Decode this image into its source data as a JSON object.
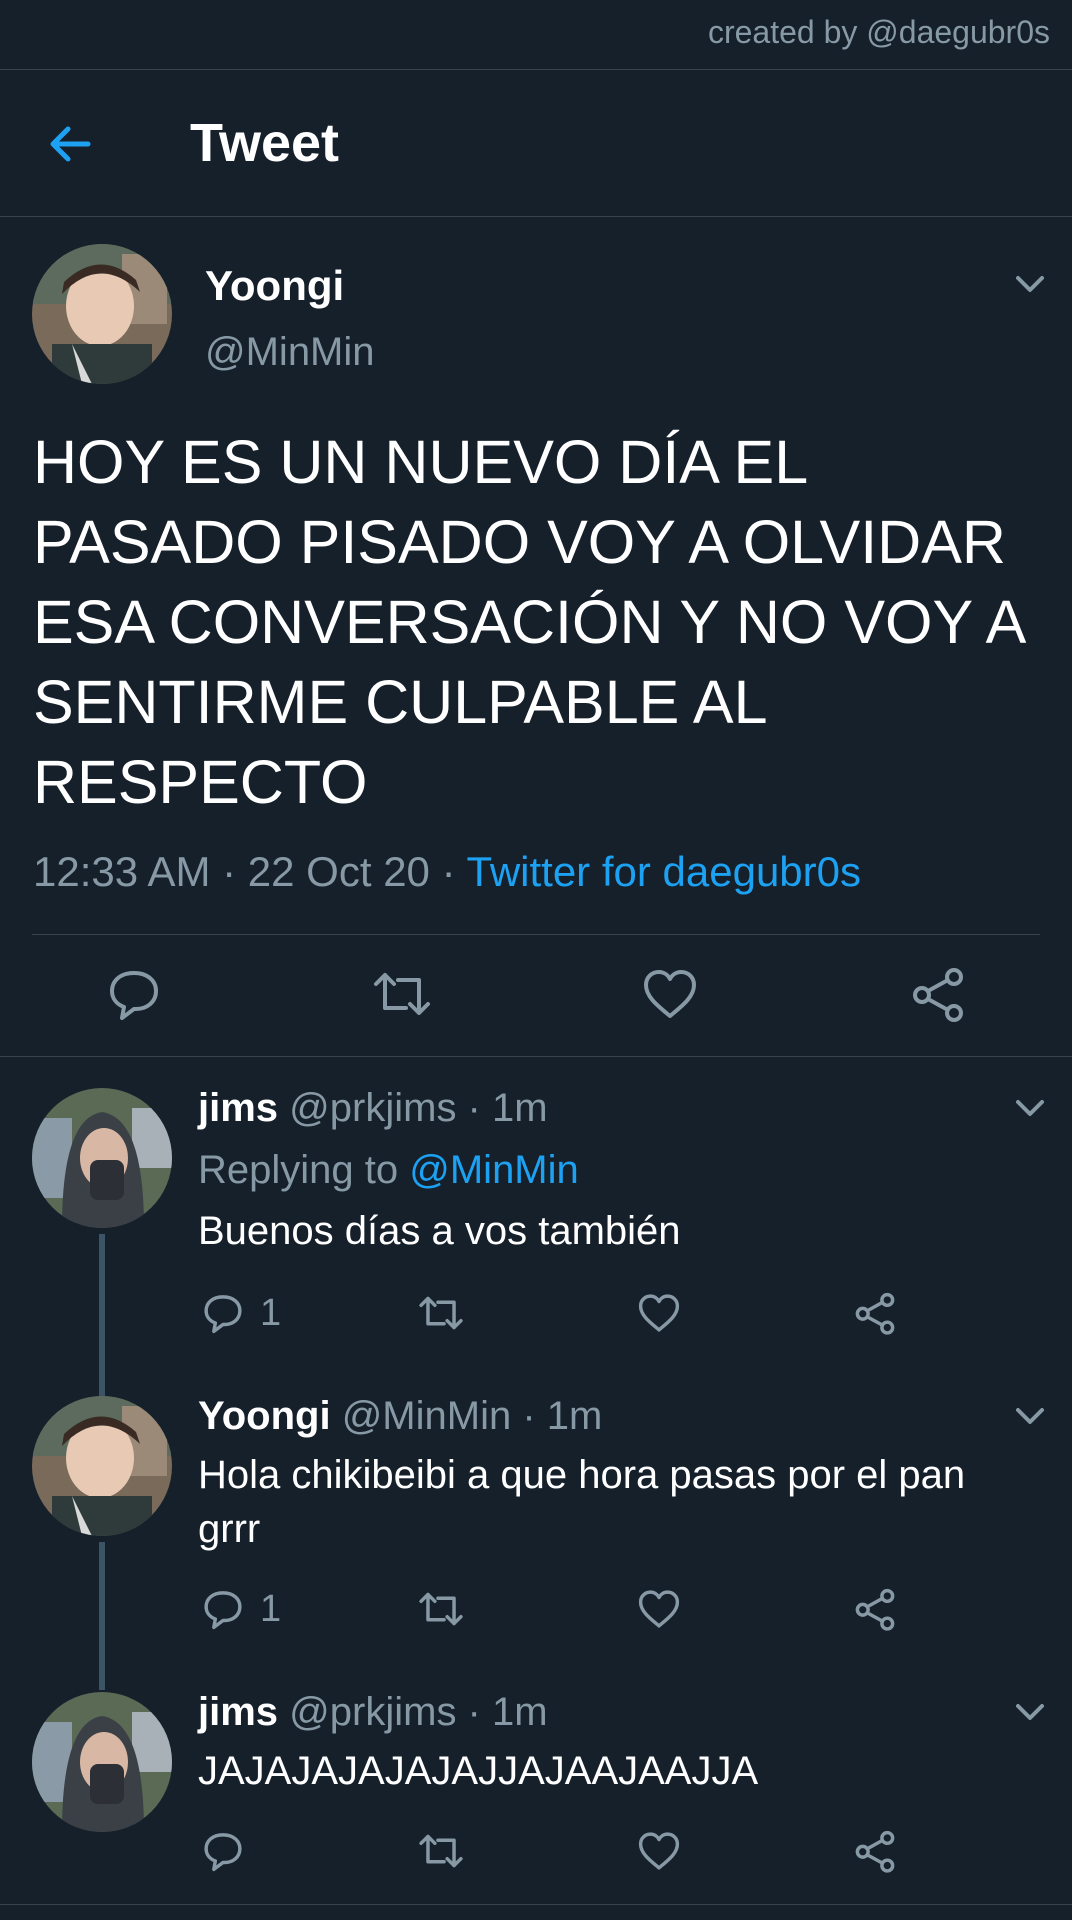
{
  "watermark": "created by @daegubr0s",
  "header": {
    "title": "Tweet"
  },
  "main_tweet": {
    "name": "Yoongi",
    "handle": "@MinMin",
    "text": "HOY ES UN NUEVO DÍA EL PASADO PISADO VOY A OLVIDAR ESA CONVERSACIÓN Y NO VOY A SENTIRME CULPABLE AL RESPECTO",
    "time": "12:33 AM",
    "date": "22 Oct 20",
    "source": "Twitter for daegubr0s"
  },
  "replies": [
    {
      "name": "jims",
      "handle": "@prkjims",
      "time": "1m",
      "replying_prefix": "Replying to",
      "replying_to": "@MinMin",
      "text": "Buenos días a vos también",
      "reply_count": "1"
    },
    {
      "name": "Yoongi",
      "handle": "@MinMin",
      "time": "1m",
      "text": "Hola chikibeibi a que hora pasas por el pan grrr",
      "reply_count": "1"
    },
    {
      "name": "jims",
      "handle": "@prkjims",
      "time": "1m",
      "text": "JAJAJAJAJAJAJJAJAAJAAJJA",
      "reply_count": ""
    }
  ],
  "separator": " · ",
  "colors": {
    "background": "#15202b",
    "accent": "#1da1f2",
    "muted": "#8899a6",
    "divider": "#38444d"
  },
  "icons": [
    "back-arrow-icon",
    "chevron-down-icon",
    "reply-icon",
    "retweet-icon",
    "like-icon",
    "share-icon"
  ]
}
